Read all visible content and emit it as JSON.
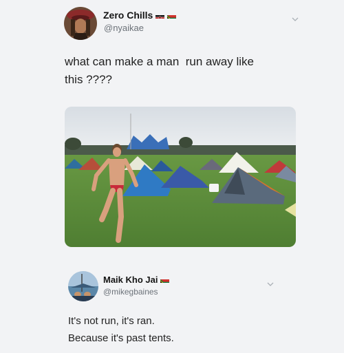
{
  "tweet1": {
    "display_name": "Zero Chills",
    "handle": "@nyaikae",
    "text_line1": "what can make a man  run away like",
    "text_line2": "this ????"
  },
  "tweet2": {
    "display_name": "Maik Kho Jai",
    "handle": "@mikegbaines",
    "text_line1": "It's not run, it's ran.",
    "text_line2": "Because it's past tents."
  },
  "icons": [
    "flag-kenya-icon",
    "flag-south-africa-icon",
    "chevron-down-icon"
  ],
  "colors": {
    "background": "#f2f3f5",
    "handle_gray": "#6b7178"
  }
}
